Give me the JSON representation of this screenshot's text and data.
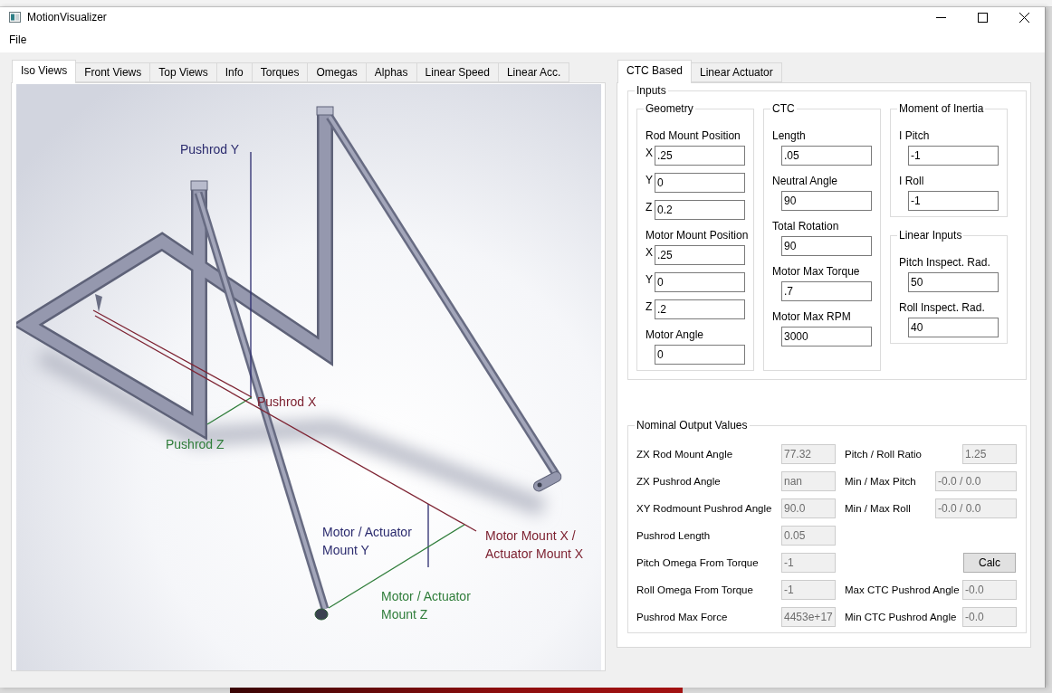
{
  "window": {
    "title": "MotionVisualizer"
  },
  "menu": [
    {
      "label": "File"
    }
  ],
  "view_tabs": [
    {
      "label": "Iso Views",
      "selected": true
    },
    {
      "label": "Front Views",
      "selected": false
    },
    {
      "label": "Top Views",
      "selected": false
    },
    {
      "label": "Info",
      "selected": false
    },
    {
      "label": "Torques",
      "selected": false
    },
    {
      "label": "Omegas",
      "selected": false
    },
    {
      "label": "Alphas",
      "selected": false
    },
    {
      "label": "Linear Speed",
      "selected": false
    },
    {
      "label": "Linear Acc.",
      "selected": false
    }
  ],
  "render": {
    "axis_labels": [
      {
        "text": "Pushrod Y",
        "color": "#2b2b6e"
      },
      {
        "text": "Pushrod X",
        "color": "#7d2231"
      },
      {
        "text": "Pushrod Z",
        "color": "#2f7d3a"
      },
      {
        "text": "Motor / Actuator\nMount Y",
        "color": "#2b2b6e"
      },
      {
        "text": "Motor Mount X /\nActuator Mount X",
        "color": "#7d2231"
      },
      {
        "text": "Motor / Actuator\nMount Z",
        "color": "#2f7d3a"
      }
    ]
  },
  "calc_tabs": [
    {
      "label": "CTC Based",
      "selected": true
    },
    {
      "label": "Linear Actuator",
      "selected": false
    }
  ],
  "inputs": {
    "title": "Inputs",
    "groups": [
      {
        "title": "Geometry",
        "items": [
          {
            "kind": "label",
            "text": "Rod Mount Position"
          },
          {
            "kind": "field",
            "axis": "X",
            "value": ".25"
          },
          {
            "kind": "field",
            "axis": "Y",
            "value": "0"
          },
          {
            "kind": "field",
            "axis": "Z",
            "value": "0.2"
          },
          {
            "kind": "label",
            "text": "Motor Mount Position"
          },
          {
            "kind": "field",
            "axis": "X",
            "value": ".25"
          },
          {
            "kind": "field",
            "axis": "Y",
            "value": "0"
          },
          {
            "kind": "field",
            "axis": "Z",
            "value": ".2"
          },
          {
            "kind": "label",
            "text": "Motor Angle"
          },
          {
            "kind": "field",
            "value": "0"
          }
        ]
      },
      {
        "title": "CTC",
        "items": [
          {
            "kind": "label",
            "text": "Length"
          },
          {
            "kind": "field",
            "value": ".05"
          },
          {
            "kind": "label",
            "text": "Neutral Angle"
          },
          {
            "kind": "field",
            "value": "90"
          },
          {
            "kind": "label",
            "text": "Total Rotation"
          },
          {
            "kind": "field",
            "value": "90"
          },
          {
            "kind": "label",
            "text": "Motor Max Torque"
          },
          {
            "kind": "field",
            "value": ".7"
          },
          {
            "kind": "label",
            "text": "Motor Max RPM"
          },
          {
            "kind": "field",
            "value": "3000"
          }
        ]
      },
      {
        "title": "Moment of Inertia",
        "items": [
          {
            "kind": "label",
            "text": "I Pitch"
          },
          {
            "kind": "field",
            "value": "-1"
          },
          {
            "kind": "label",
            "text": "I Roll"
          },
          {
            "kind": "field",
            "value": "-1"
          }
        ]
      },
      {
        "title": "Linear Inputs",
        "items": [
          {
            "kind": "label",
            "text": "Pitch Inspect. Rad."
          },
          {
            "kind": "field",
            "value": "50"
          },
          {
            "kind": "label",
            "text": "Roll Inspect. Rad."
          },
          {
            "kind": "field",
            "value": "40"
          }
        ]
      }
    ]
  },
  "outputs": {
    "title": "Nominal Output Values",
    "left": [
      {
        "label": "ZX Rod Mount Angle",
        "value": "77.32",
        "disabled": true
      },
      {
        "label": "ZX Pushrod Angle",
        "value": "nan",
        "disabled": true
      },
      {
        "label": "XY Rodmount Pushrod Angle",
        "value": "90.0",
        "disabled": true
      },
      {
        "label": "Pushrod Length",
        "value": "0.05",
        "disabled": true
      },
      {
        "label": "Pitch Omega From Torque",
        "value": "-1",
        "disabled": true
      },
      {
        "label": "Roll Omega From Torque",
        "value": "-1",
        "disabled": true
      },
      {
        "label": "Pushrod Max Force",
        "value": "4453e+17",
        "disabled": true
      }
    ],
    "right": [
      {
        "kind": "field",
        "label": "Pitch / Roll Ratio",
        "value": "1.25",
        "disabled": true
      },
      {
        "kind": "pair",
        "label": "Min / Max Pitch",
        "value": "-0.0 / 0.0",
        "disabled": true
      },
      {
        "kind": "pair",
        "label": "Min / Max Roll",
        "value": "-0.0 / 0.0",
        "disabled": true
      },
      {
        "kind": "button",
        "label": "Calc"
      },
      {
        "kind": "field",
        "label": "Max CTC Pushrod Angle",
        "value": "-0.0",
        "disabled": true
      },
      {
        "kind": "field",
        "label": "Min CTC Pushrod Angle",
        "value": "-0.0",
        "disabled": true
      }
    ]
  }
}
